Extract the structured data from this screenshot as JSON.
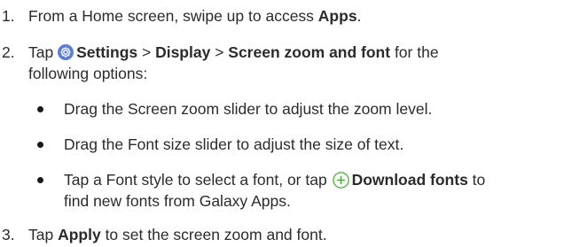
{
  "steps": [
    {
      "number": "1.",
      "parts": [
        "From a Home screen, swipe up to access ",
        "Apps",
        "."
      ]
    },
    {
      "number": "2.",
      "tap": "Tap ",
      "settings": "Settings",
      "sep1": " > ",
      "display": "Display",
      "sep2": " > ",
      "zoom_font": "Screen zoom and font",
      "rest_line1": " for the",
      "rest_line2": "following options:"
    },
    {
      "number": "3.",
      "parts": [
        "Tap ",
        "Apply",
        " to set the screen zoom and font."
      ]
    }
  ],
  "bullets": [
    {
      "text": "Drag the Screen zoom slider to adjust the zoom level."
    },
    {
      "text": "Drag the Font size slider to adjust the size of text."
    },
    {
      "prefix": "Tap a Font style to select a font, or tap ",
      "action": "Download fonts",
      "suffix_line1": " to",
      "suffix_line2": "find new fonts from Galaxy Apps."
    }
  ],
  "icons": {
    "settings": "gear-icon",
    "download": "plus-circle-icon"
  },
  "colors": {
    "settings_icon": "#5c7fd6",
    "plus_icon": "#4caf3c"
  }
}
